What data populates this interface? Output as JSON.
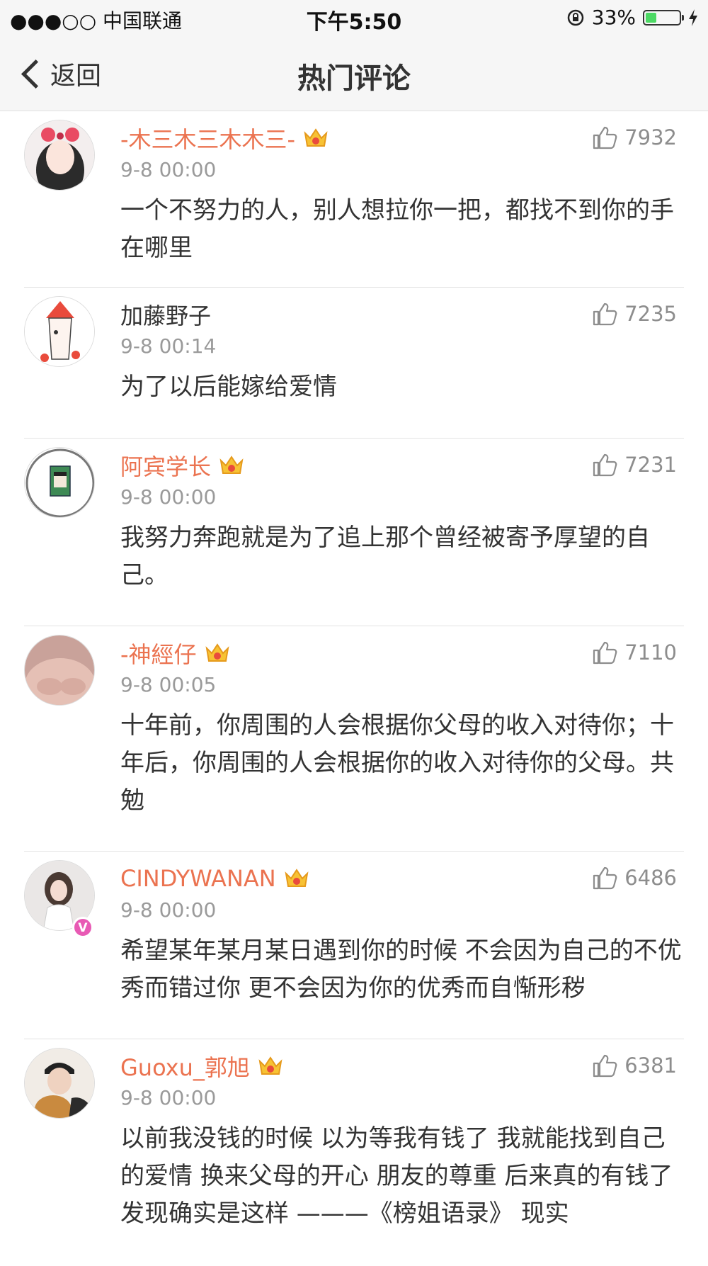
{
  "status_bar": {
    "carrier": "●●●○○ 中国联通",
    "time": "下午5:50",
    "battery": "33%",
    "battery_level": 0.33
  },
  "nav": {
    "back_label": "返回",
    "title": "热门评论"
  },
  "comments": [
    {
      "username": "-木三木三木木三-",
      "time": "9-8 00:00",
      "likes": "7932",
      "text": "一个不努力的人，别人想拉你一把，都找不到你的手在哪里"
    },
    {
      "username": "加藤野子",
      "time": "9-8 00:14",
      "likes": "7235",
      "text": "为了以后能嫁给爱情"
    },
    {
      "username": "阿宾学长",
      "time": "9-8 00:00",
      "likes": "7231",
      "text": "我努力奔跑就是为了追上那个曾经被寄予厚望的自己。"
    },
    {
      "username": "-神經仔",
      "time": "9-8 00:05",
      "likes": "7110",
      "text": "十年前，你周围的人会根据你父母的收入对待你；十年后，你周围的人会根据你的收入对待你的父母。共勉"
    },
    {
      "username": "CINDYWANAN",
      "time": "9-8 00:00",
      "likes": "6486",
      "text": "希望某年某月某日遇到你的时候 不会因为自己的不优秀而错过你 更不会因为你的优秀而自惭形秽"
    },
    {
      "username": "Guoxu_郭旭",
      "time": "9-8 00:00",
      "likes": "6381",
      "text": "以前我没钱的时候 以为等我有钱了 我就能找到自己的爱情 换来父母的开心 朋友的尊重 后来真的有钱了 发现确实是这样 ———《榜姐语录》 现实"
    }
  ],
  "colors": {
    "accent": "#eb7350",
    "vip_badge": "#e85ab4",
    "bar_bg": "#f6f6f6"
  }
}
